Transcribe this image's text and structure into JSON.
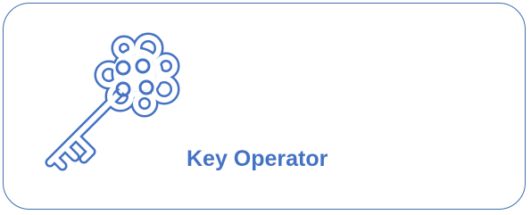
{
  "card": {
    "title": "Key Operator",
    "icon": "key-icon",
    "border_color": "#3d6fb0",
    "text_color": "#4472c4"
  }
}
